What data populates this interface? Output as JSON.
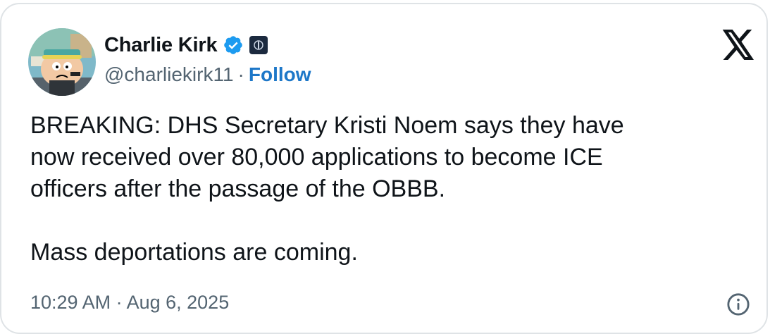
{
  "author": {
    "display_name": "Charlie Kirk",
    "handle": "@charliekirk11",
    "separator": "·",
    "follow_label": "Follow",
    "verified_icon": "verified-badge-icon",
    "affiliate_icon": "affiliate-badge-icon",
    "avatar_icon": "avatar-cartoon-character"
  },
  "tweet": {
    "text": "BREAKING: DHS Secretary Kristi Noem says they have\nnow received over 80,000 applications to become ICE\nofficers after the passage of the OBBB.\n\nMass deportations are coming.",
    "timestamp": "10:29 AM · Aug 6, 2025"
  },
  "icons": {
    "logo": "x-logo-icon",
    "info": "info-icon"
  },
  "colors": {
    "text_primary": "#0f1419",
    "text_secondary": "#536471",
    "follow_blue": "#1d77c8",
    "verified_blue": "#1d9bf0",
    "border": "#dfe3e6"
  }
}
